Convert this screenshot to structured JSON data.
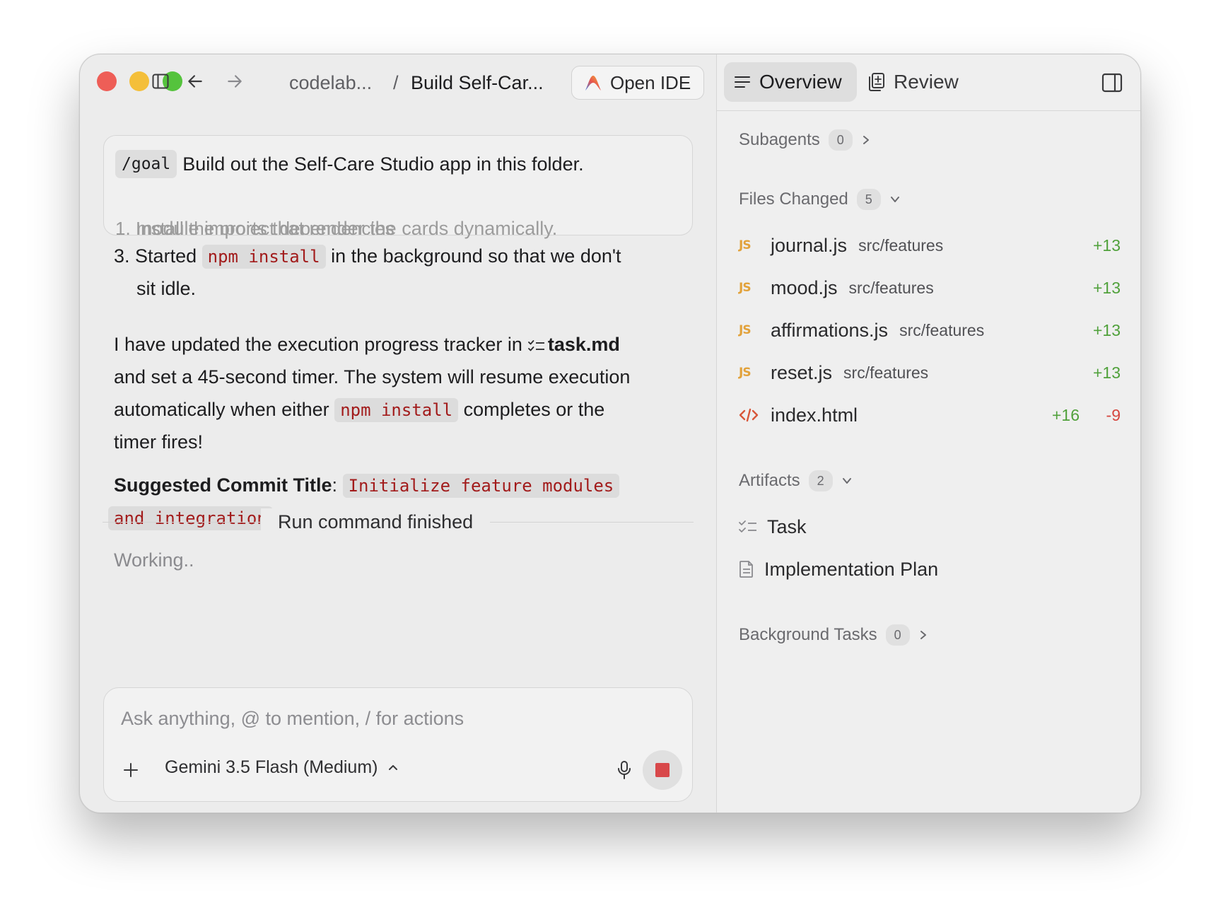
{
  "header": {
    "breadcrumb_project": "codelab...",
    "breadcrumb_separator": "/",
    "breadcrumb_title": "Build Self-Car...",
    "open_ide_label": "Open IDE"
  },
  "goal": {
    "tag": "/goal",
    "text": "Build out the Self-Care Studio app in this folder.",
    "faded_step": "1. Install the project dependencies"
  },
  "chat": {
    "faded_line": "module imports that render the cards dynamically.",
    "step3_number": "3.",
    "step3_pre": "Started",
    "step3_code": "npm install",
    "step3_post": "in the background so that we don't",
    "step3_line2": "sit idle.",
    "para_pre": "I have updated the execution progress tracker in",
    "para_file": "task.md",
    "para_line2": "and set a 45-second timer. The system will resume execution",
    "para_line3_pre": "automatically when either",
    "para_line3_code": "npm install",
    "para_line3_post": "completes or the",
    "para_line4": "timer fires!",
    "commit_label": "Suggested Commit Title",
    "commit_colon": ":",
    "commit_code1": "Initialize feature modules",
    "commit_code2": "and integration",
    "run_status": "Run command finished",
    "working": "Working.."
  },
  "input": {
    "placeholder": "Ask anything, @ to mention, / for actions",
    "model": "Gemini 3.5 Flash (Medium)"
  },
  "right_panel": {
    "tabs": [
      {
        "label": "Overview",
        "active": true
      },
      {
        "label": "Review",
        "active": false
      }
    ],
    "subagents": {
      "label": "Subagents",
      "count": "0"
    },
    "files_changed": {
      "label": "Files Changed",
      "count": "5",
      "files": [
        {
          "icon": "JS",
          "name": "journal.js",
          "path": "src/features",
          "added": "+13"
        },
        {
          "icon": "JS",
          "name": "mood.js",
          "path": "src/features",
          "added": "+13"
        },
        {
          "icon": "JS",
          "name": "affirmations.js",
          "path": "src/features",
          "added": "+13"
        },
        {
          "icon": "JS",
          "name": "reset.js",
          "path": "src/features",
          "added": "+13"
        },
        {
          "icon": "html",
          "name": "index.html",
          "path": "",
          "added": "+16",
          "removed": "-9"
        }
      ]
    },
    "artifacts": {
      "label": "Artifacts",
      "count": "2",
      "items": [
        "Task",
        "Implementation Plan"
      ]
    },
    "background_tasks": {
      "label": "Background Tasks",
      "count": "0"
    }
  },
  "colors": {
    "traffic_red": "#ee5e57",
    "traffic_yellow": "#f4bf3a",
    "traffic_green": "#55c33d",
    "code_text": "#a21b1b",
    "added": "#50a13b",
    "removed": "#d6473f",
    "js_icon": "#e2a23b",
    "stop": "#d8484a"
  }
}
